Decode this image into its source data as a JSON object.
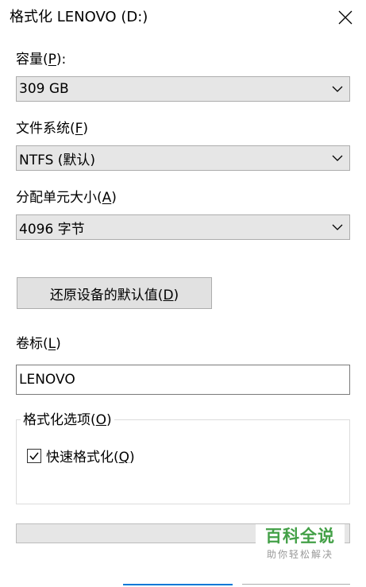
{
  "window": {
    "title": "格式化 LENOVO (D:)"
  },
  "capacity": {
    "label_text": "容量(",
    "label_key": "P",
    "label_end": "):",
    "value": "309 GB"
  },
  "filesystem": {
    "label_text": "文件系统(",
    "label_key": "F",
    "label_end": ")",
    "value": "NTFS (默认)"
  },
  "allocation": {
    "label_text": "分配单元大小(",
    "label_key": "A",
    "label_end": ")",
    "value": "4096 字节"
  },
  "restore_button": {
    "label_text": "还原设备的默认值(",
    "label_key": "D",
    "label_end": ")"
  },
  "volume_label": {
    "label_text": "卷标(",
    "label_key": "L",
    "label_end": ")",
    "value": "LENOVO"
  },
  "format_options": {
    "title_text": "格式化选项(",
    "title_key": "O",
    "title_end": ")",
    "quick_format": {
      "label_text": "快速格式化(",
      "label_key": "Q",
      "label_end": ")",
      "checked": true
    }
  },
  "progress": {
    "value": 0
  },
  "watermark": {
    "main": "百科全说",
    "sub": "助你轻松解决"
  },
  "colors": {
    "accent": "#0078d7",
    "watermark_green": "#43a047"
  }
}
